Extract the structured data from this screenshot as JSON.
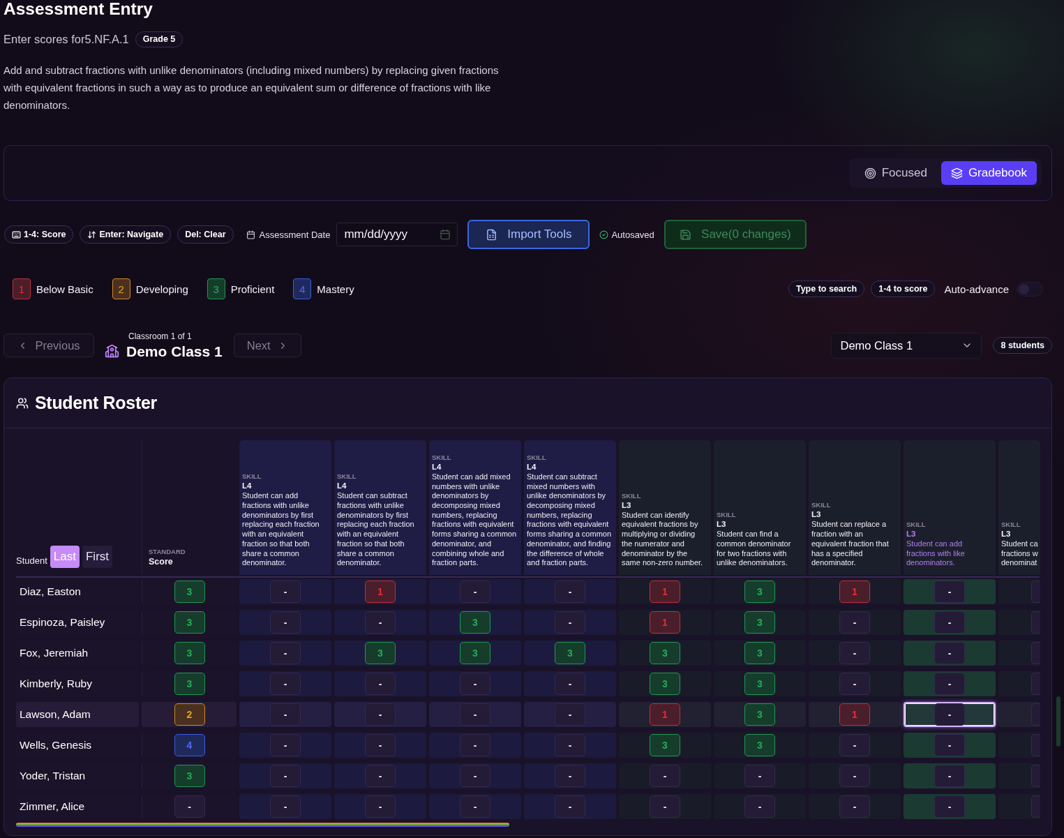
{
  "header": {
    "title": "Assessment Entry",
    "subtitle": "Enter scores for5.NF.A.1",
    "grade_badge": "Grade 5",
    "description": "Add and subtract fractions with unlike denominators (including mixed numbers) by replacing given fractions with equivalent fractions in such a way as to produce an equivalent sum or difference of fractions with like denominators."
  },
  "view_toggle": [
    {
      "label": "Focused",
      "selected": false
    },
    {
      "label": "Gradebook",
      "selected": true
    }
  ],
  "toolbar": {
    "shortcuts": [
      "1-4: Score",
      "Enter: Navigate",
      "Del: Clear"
    ],
    "date_label": "Assessment Date",
    "date_field": {
      "placeholder": "mm/dd/yyyy"
    },
    "import_button": "Import Tools",
    "autosave_status": "Autosaved",
    "save_button": {
      "label": "Save(0 changes)",
      "disabled": true
    }
  },
  "legend": [
    {
      "kind": "below",
      "score": "1",
      "label": "Below Basic"
    },
    {
      "kind": "developing",
      "score": "2",
      "label": "Developing"
    },
    {
      "kind": "proficient",
      "score": "3",
      "label": "Proficient"
    },
    {
      "kind": "mastery",
      "score": "4",
      "label": "Mastery"
    }
  ],
  "hints": [
    "Type to search",
    "1-4 to score"
  ],
  "auto_advance": {
    "label": "Auto-advance",
    "on": false
  },
  "classroom_nav": {
    "previous": {
      "label": "Previous",
      "disabled": true
    },
    "counter": "Classroom 1 of 1",
    "name": "Demo Class 1",
    "next": {
      "label": "Next",
      "disabled": true
    }
  },
  "class_select": {
    "value": "Demo Class 1"
  },
  "student_count": "8 students",
  "roster": {
    "title": "Student Roster",
    "student_column": {
      "label": "Student",
      "sort": [
        {
          "label": "Last",
          "selected": true
        },
        {
          "label": "First",
          "selected": false
        }
      ]
    },
    "standard_column": {
      "kicker": "STANDARD",
      "label": "Score"
    },
    "skill_columns": [
      {
        "kicker": "SKILL",
        "level": "L4",
        "description": "Student can add fractions with unlike denominators by first replacing each fraction with an equivalent fraction so that both share a common denominator.",
        "color": "#1f1c45",
        "selected": false
      },
      {
        "kicker": "SKILL",
        "level": "L4",
        "description": "Student can subtract fractions with unlike denominators by first replacing each fraction with an equivalent fraction so that both share a common denominator.",
        "color": "#1f1c45",
        "selected": false
      },
      {
        "kicker": "SKILL",
        "level": "L4",
        "description": "Student can add mixed numbers with unlike denominators by decomposing mixed numbers, replacing fractions with equivalent forms sharing a common denominator, and combining whole and fraction parts.",
        "color": "#1f1c45",
        "selected": false
      },
      {
        "kicker": "SKILL",
        "level": "L4",
        "description": "Student can subtract mixed numbers with unlike denominators by decomposing mixed numbers, replacing fractions with equivalent forms sharing a common denominator, and finding the difference of whole and fraction parts.",
        "color": "#1f1c45",
        "selected": false
      },
      {
        "kicker": "SKILL",
        "level": "L3",
        "description": "Student can identify equivalent fractions by multiplying or dividing the numerator and denominator by the same non-zero number.",
        "color": "#1b1f2b",
        "selected": false
      },
      {
        "kicker": "SKILL",
        "level": "L3",
        "description": "Student can find a common denominator for two fractions with unlike denominators.",
        "color": "#1b1f2b",
        "selected": false
      },
      {
        "kicker": "SKILL",
        "level": "L3",
        "description": "Student can replace a fraction with an equivalent fraction that has a specified denominator.",
        "color": "#1b1f2b",
        "selected": false
      },
      {
        "kicker": "SKILL",
        "level": "L3",
        "description": "Student can add fractions with like denominators.",
        "color": "#1b1f2b",
        "selected": true
      },
      {
        "kicker": "SKILL",
        "level": "L3",
        "description": "Student ca fractions w denominat",
        "color": "#1b1f2b",
        "selected": false
      }
    ],
    "rows": [
      {
        "student": "Diaz, Easton",
        "selected": false,
        "standard": {
          "value": "3",
          "kind": "proficient",
          "selected": false
        },
        "skills": [
          {
            "value": "-",
            "kind": "empty",
            "selected": false
          },
          {
            "value": "1",
            "kind": "below",
            "selected": false
          },
          {
            "value": "-",
            "kind": "empty",
            "selected": false
          },
          {
            "value": "-",
            "kind": "empty",
            "selected": false
          },
          {
            "value": "1",
            "kind": "below",
            "selected": false
          },
          {
            "value": "3",
            "kind": "proficient",
            "selected": false
          },
          {
            "value": "1",
            "kind": "below",
            "selected": false
          },
          {
            "value": "-",
            "kind": "empty",
            "selected": false
          }
        ]
      },
      {
        "student": "Espinoza, Paisley",
        "selected": false,
        "standard": {
          "value": "3",
          "kind": "proficient",
          "selected": false
        },
        "skills": [
          {
            "value": "-",
            "kind": "empty",
            "selected": false
          },
          {
            "value": "-",
            "kind": "empty",
            "selected": false
          },
          {
            "value": "3",
            "kind": "proficient",
            "selected": false
          },
          {
            "value": "-",
            "kind": "empty",
            "selected": false
          },
          {
            "value": "1",
            "kind": "below",
            "selected": false
          },
          {
            "value": "3",
            "kind": "proficient",
            "selected": false
          },
          {
            "value": "-",
            "kind": "empty",
            "selected": false
          },
          {
            "value": "-",
            "kind": "empty",
            "selected": false
          }
        ]
      },
      {
        "student": "Fox, Jeremiah",
        "selected": false,
        "standard": {
          "value": "3",
          "kind": "proficient",
          "selected": false
        },
        "skills": [
          {
            "value": "-",
            "kind": "empty",
            "selected": false
          },
          {
            "value": "3",
            "kind": "proficient",
            "selected": false
          },
          {
            "value": "3",
            "kind": "proficient",
            "selected": false
          },
          {
            "value": "3",
            "kind": "proficient",
            "selected": false
          },
          {
            "value": "3",
            "kind": "proficient",
            "selected": false
          },
          {
            "value": "3",
            "kind": "proficient",
            "selected": false
          },
          {
            "value": "-",
            "kind": "empty",
            "selected": false
          },
          {
            "value": "-",
            "kind": "empty",
            "selected": false
          }
        ]
      },
      {
        "student": "Kimberly, Ruby",
        "selected": false,
        "standard": {
          "value": "3",
          "kind": "proficient",
          "selected": false
        },
        "skills": [
          {
            "value": "-",
            "kind": "empty",
            "selected": false
          },
          {
            "value": "-",
            "kind": "empty",
            "selected": false
          },
          {
            "value": "-",
            "kind": "empty",
            "selected": false
          },
          {
            "value": "-",
            "kind": "empty",
            "selected": false
          },
          {
            "value": "3",
            "kind": "proficient",
            "selected": false
          },
          {
            "value": "3",
            "kind": "proficient",
            "selected": false
          },
          {
            "value": "-",
            "kind": "empty",
            "selected": false
          },
          {
            "value": "-",
            "kind": "empty",
            "selected": false
          }
        ]
      },
      {
        "student": "Lawson, Adam",
        "selected": true,
        "standard": {
          "value": "2",
          "kind": "developing",
          "selected": false
        },
        "skills": [
          {
            "value": "-",
            "kind": "empty",
            "selected": false
          },
          {
            "value": "-",
            "kind": "empty",
            "selected": false
          },
          {
            "value": "-",
            "kind": "empty",
            "selected": false
          },
          {
            "value": "-",
            "kind": "empty",
            "selected": false
          },
          {
            "value": "1",
            "kind": "below",
            "selected": false
          },
          {
            "value": "3",
            "kind": "proficient",
            "selected": false
          },
          {
            "value": "1",
            "kind": "below",
            "selected": false
          },
          {
            "value": "-",
            "kind": "empty",
            "selected": true
          }
        ]
      },
      {
        "student": "Wells, Genesis",
        "selected": false,
        "standard": {
          "value": "4",
          "kind": "mastery",
          "selected": false
        },
        "skills": [
          {
            "value": "-",
            "kind": "empty",
            "selected": false
          },
          {
            "value": "-",
            "kind": "empty",
            "selected": false
          },
          {
            "value": "-",
            "kind": "empty",
            "selected": false
          },
          {
            "value": "-",
            "kind": "empty",
            "selected": false
          },
          {
            "value": "3",
            "kind": "proficient",
            "selected": false
          },
          {
            "value": "3",
            "kind": "proficient",
            "selected": false
          },
          {
            "value": "-",
            "kind": "empty",
            "selected": false
          },
          {
            "value": "-",
            "kind": "empty",
            "selected": false
          }
        ]
      },
      {
        "student": "Yoder, Tristan",
        "selected": false,
        "standard": {
          "value": "3",
          "kind": "proficient",
          "selected": false
        },
        "skills": [
          {
            "value": "-",
            "kind": "empty",
            "selected": false
          },
          {
            "value": "-",
            "kind": "empty",
            "selected": false
          },
          {
            "value": "-",
            "kind": "empty",
            "selected": false
          },
          {
            "value": "-",
            "kind": "empty",
            "selected": false
          },
          {
            "value": "-",
            "kind": "empty",
            "selected": false
          },
          {
            "value": "-",
            "kind": "empty",
            "selected": false
          },
          {
            "value": "-",
            "kind": "empty",
            "selected": false
          },
          {
            "value": "-",
            "kind": "empty",
            "selected": false
          }
        ]
      },
      {
        "student": "Zimmer, Alice",
        "selected": false,
        "standard": {
          "value": "-",
          "kind": "empty",
          "selected": false
        },
        "skills": [
          {
            "value": "-",
            "kind": "empty",
            "selected": false
          },
          {
            "value": "-",
            "kind": "empty",
            "selected": false
          },
          {
            "value": "-",
            "kind": "empty",
            "selected": false
          },
          {
            "value": "-",
            "kind": "empty",
            "selected": false
          },
          {
            "value": "-",
            "kind": "empty",
            "selected": false
          },
          {
            "value": "-",
            "kind": "empty",
            "selected": false
          },
          {
            "value": "-",
            "kind": "empty",
            "selected": false
          },
          {
            "value": "-",
            "kind": "empty",
            "selected": false
          }
        ]
      }
    ]
  }
}
